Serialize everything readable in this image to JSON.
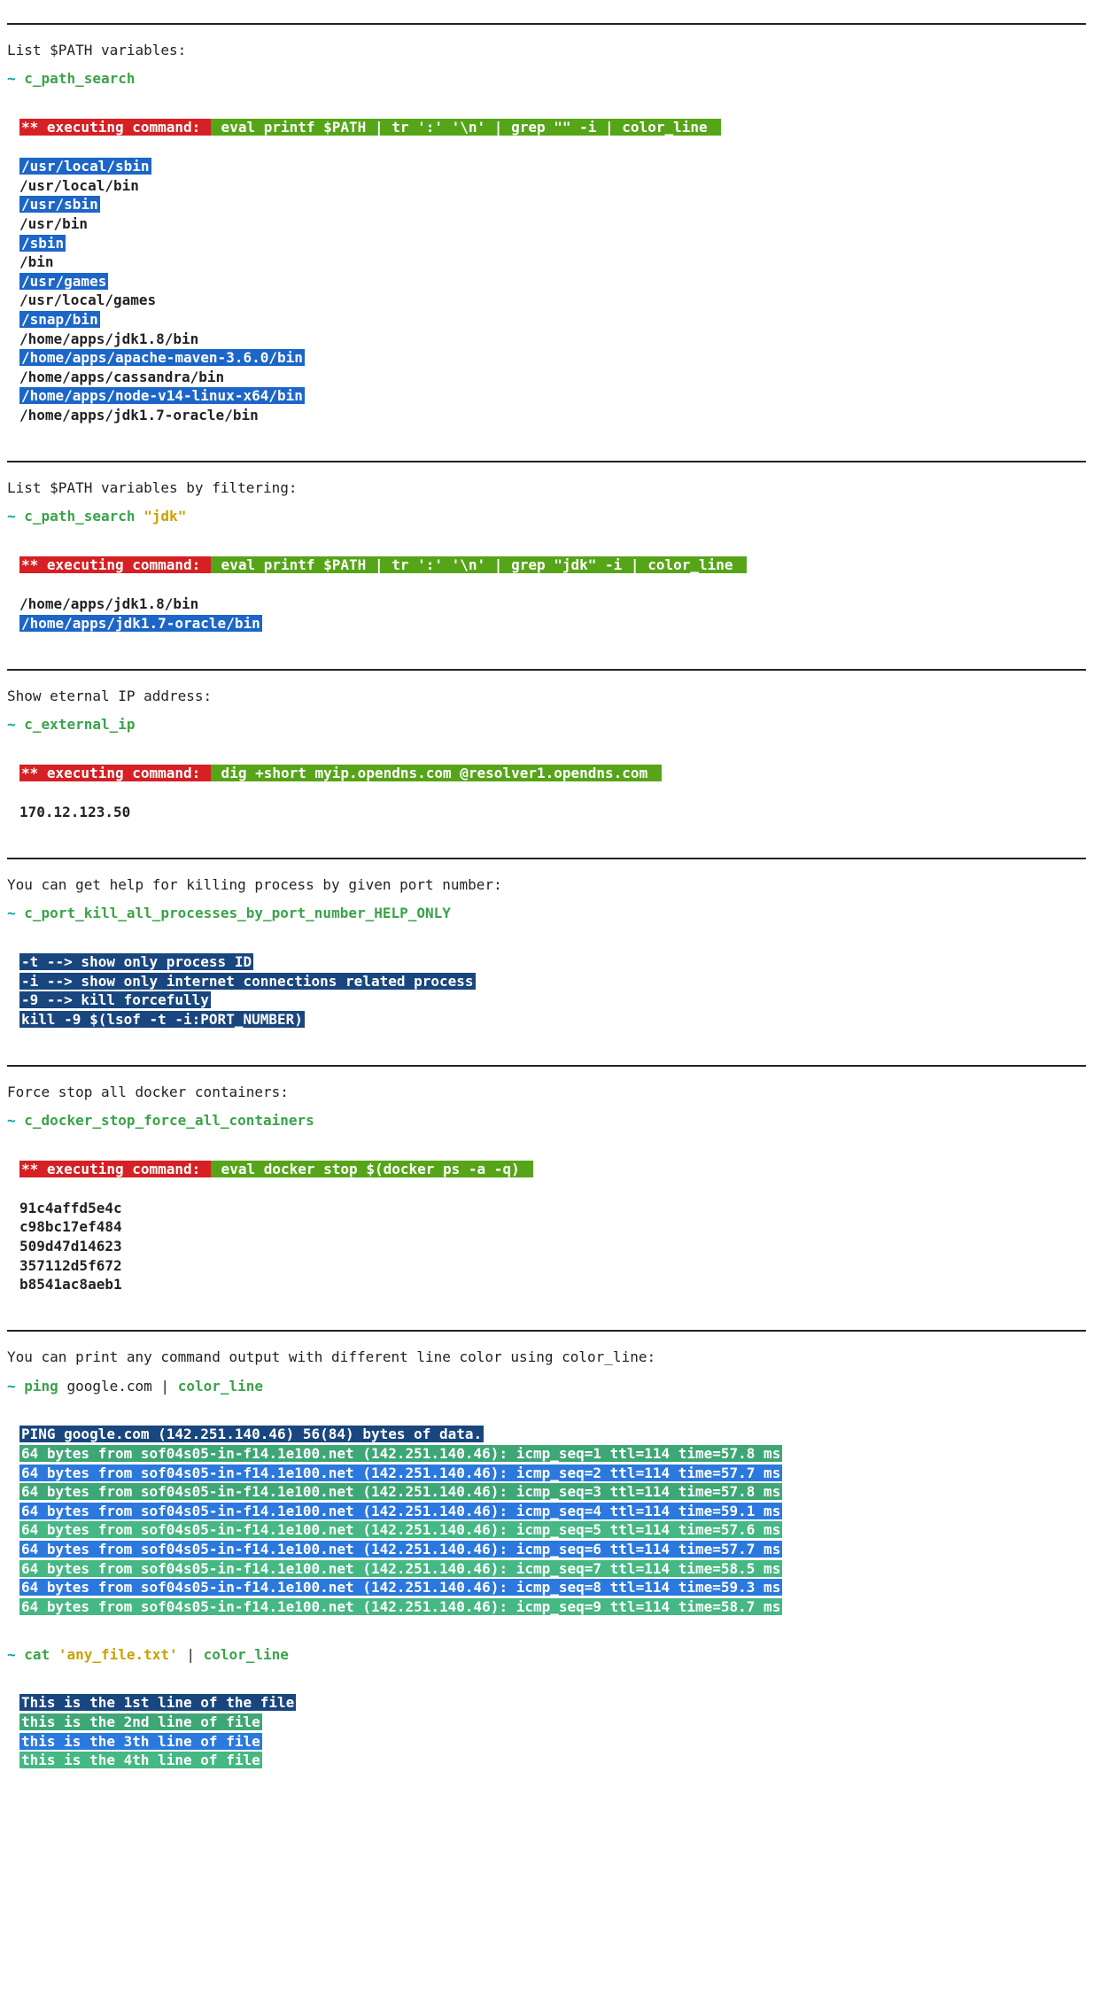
{
  "sections": {
    "path_search": {
      "desc": "List $PATH variables:",
      "tilde": "~",
      "command": "c_path_search",
      "exec_label": "** executing command: ",
      "exec_cmd": " eval printf $PATH | tr ':' '\\n' | grep \"\" -i | color_line ",
      "lines": [
        {
          "text": "/usr/local/sbin",
          "style": "hl-blue1"
        },
        {
          "text": "/usr/local/bin",
          "style": "out-plain"
        },
        {
          "text": "/usr/sbin",
          "style": "hl-blue1"
        },
        {
          "text": "/usr/bin",
          "style": "out-plain"
        },
        {
          "text": "/sbin",
          "style": "hl-blue1"
        },
        {
          "text": "/bin",
          "style": "out-plain"
        },
        {
          "text": "/usr/games",
          "style": "hl-blue1"
        },
        {
          "text": "/usr/local/games",
          "style": "out-plain"
        },
        {
          "text": "/snap/bin",
          "style": "hl-blue1"
        },
        {
          "text": "/home/apps/jdk1.8/bin",
          "style": "out-plain"
        },
        {
          "text": "/home/apps/apache-maven-3.6.0/bin",
          "style": "hl-blue1"
        },
        {
          "text": "/home/apps/cassandra/bin",
          "style": "out-plain"
        },
        {
          "text": "/home/apps/node-v14-linux-x64/bin",
          "style": "hl-blue1"
        },
        {
          "text": "/home/apps/jdk1.7-oracle/bin",
          "style": "out-plain"
        }
      ]
    },
    "path_search_filter": {
      "desc": "List $PATH variables by filtering:",
      "tilde": "~",
      "command": "c_path_search",
      "arg": "\"jdk\"",
      "exec_label": "** executing command: ",
      "exec_cmd": " eval printf $PATH | tr ':' '\\n' | grep \"jdk\" -i | color_line ",
      "lines": [
        {
          "text": "/home/apps/jdk1.8/bin",
          "style": "out-plain"
        },
        {
          "text": "/home/apps/jdk1.7-oracle/bin",
          "style": "hl-blue1"
        }
      ]
    },
    "external_ip": {
      "desc": "Show eternal IP address:",
      "tilde": "~",
      "command": "c_external_ip",
      "exec_label": "** executing command: ",
      "exec_cmd": " dig +short myip.opendns.com @resolver1.opendns.com ",
      "lines": [
        {
          "text": "170.12.123.50",
          "style": "out-plain"
        }
      ]
    },
    "port_kill": {
      "desc": "You can get help for killing process by given port number:",
      "tilde": "~",
      "command": "c_port_kill_all_processes_by_port_number_HELP_ONLY",
      "lines": [
        {
          "text": "-t --> show only process ID",
          "style": "hl-navy"
        },
        {
          "text": "-i --> show only internet connections related process",
          "style": "hl-navy"
        },
        {
          "text": "-9 --> kill forcefully",
          "style": "hl-navy"
        },
        {
          "text": "kill -9 $(lsof -t -i:PORT_NUMBER)",
          "style": "hl-navy"
        }
      ]
    },
    "docker_stop": {
      "desc": "Force stop all docker containers:",
      "tilde": "~",
      "command": "c_docker_stop_force_all_containers",
      "exec_label": "** executing command: ",
      "exec_cmd": " eval docker stop $(docker ps -a -q) ",
      "lines": [
        {
          "text": "91c4affd5e4c",
          "style": "out-plain"
        },
        {
          "text": "c98bc17ef484",
          "style": "out-plain"
        },
        {
          "text": "509d47d14623",
          "style": "out-plain"
        },
        {
          "text": "357112d5f672",
          "style": "out-plain"
        },
        {
          "text": "b8541ac8aeb1",
          "style": "out-plain"
        }
      ]
    },
    "color_line_demo": {
      "desc": "You can print any command output with different line color using color_line:",
      "tilde": "~",
      "ping_cmd": "ping",
      "ping_arg": "google.com",
      "pipe": " | ",
      "color_line": "color_line",
      "lines": [
        {
          "text": "PING google.com (142.251.140.46) 56(84) bytes of data.",
          "style": "hl-navy"
        },
        {
          "text": "64 bytes from sof04s05-in-f14.1e100.net (142.251.140.46): icmp_seq=1 ttl=114 time=57.8 ms",
          "style": "hl-green1"
        },
        {
          "text": "64 bytes from sof04s05-in-f14.1e100.net (142.251.140.46): icmp_seq=2 ttl=114 time=57.7 ms",
          "style": "hl-blue2"
        },
        {
          "text": "64 bytes from sof04s05-in-f14.1e100.net (142.251.140.46): icmp_seq=3 ttl=114 time=57.8 ms",
          "style": "hl-green1"
        },
        {
          "text": "64 bytes from sof04s05-in-f14.1e100.net (142.251.140.46): icmp_seq=4 ttl=114 time=59.1 ms",
          "style": "hl-blue2"
        },
        {
          "text": "64 bytes from sof04s05-in-f14.1e100.net (142.251.140.46): icmp_seq=5 ttl=114 time=57.6 ms",
          "style": "hl-green2"
        },
        {
          "text": "64 bytes from sof04s05-in-f14.1e100.net (142.251.140.46): icmp_seq=6 ttl=114 time=57.7 ms",
          "style": "hl-blue2"
        },
        {
          "text": "64 bytes from sof04s05-in-f14.1e100.net (142.251.140.46): icmp_seq=7 ttl=114 time=58.5 ms",
          "style": "hl-green2"
        },
        {
          "text": "64 bytes from sof04s05-in-f14.1e100.net (142.251.140.46): icmp_seq=8 ttl=114 time=59.3 ms",
          "style": "hl-blue2"
        },
        {
          "text": "64 bytes from sof04s05-in-f14.1e100.net (142.251.140.46): icmp_seq=9 ttl=114 time=58.7 ms",
          "style": "hl-green2"
        }
      ],
      "cat_cmd": "cat",
      "cat_arg": "'any_file.txt'",
      "cat_lines": [
        {
          "text": "This is the 1st line of the file",
          "style": "hl-navy"
        },
        {
          "text": "this is the 2nd line of file",
          "style": "hl-green1"
        },
        {
          "text": "this is the 3th line of file",
          "style": "hl-blue2"
        },
        {
          "text": "this is the 4th line of file",
          "style": "hl-green2"
        }
      ]
    }
  }
}
